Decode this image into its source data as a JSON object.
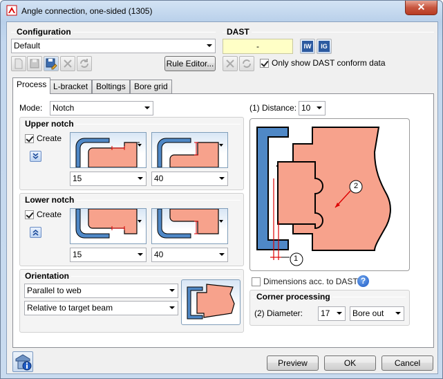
{
  "window": {
    "title": "Angle connection, one-sided (1305)",
    "close_label": "✕"
  },
  "configuration": {
    "title": "Configuration",
    "selected": "Default",
    "rule_editor_label": "Rule Editor..."
  },
  "dast": {
    "title": "DAST",
    "value": "-",
    "iw_label": "IW",
    "ig_label": "IG",
    "only_conform_label": "Only show DAST conform data",
    "only_conform_checked": true
  },
  "tabs": [
    {
      "label": "Process",
      "active": true
    },
    {
      "label": "L-bracket"
    },
    {
      "label": "Boltings"
    },
    {
      "label": "Bore grid"
    }
  ],
  "process": {
    "mode_label": "Mode:",
    "mode_value": "Notch",
    "upper_notch": {
      "title": "Upper notch",
      "create_label": "Create",
      "create_checked": true,
      "value1": "15",
      "value2": "40"
    },
    "lower_notch": {
      "title": "Lower notch",
      "create_label": "Create",
      "create_checked": true,
      "value1": "15",
      "value2": "40"
    },
    "orientation": {
      "title": "Orientation",
      "value1": "Parallel to web",
      "value2": "Relative to target beam"
    },
    "distance_label": "(1) Distance:",
    "distance_value": "10",
    "callout_1": "1",
    "callout_2": "2",
    "dims_dast_label": "Dimensions acc. to DAST",
    "dims_dast_checked": false,
    "help_label": "?",
    "corner": {
      "title": "Corner processing",
      "diameter_label": "(2) Diameter:",
      "diameter_value": "17",
      "type_value": "Bore out"
    }
  },
  "footer": {
    "preview_label": "Preview",
    "ok_label": "OK",
    "cancel_label": "Cancel"
  },
  "colors": {
    "steel_blue": "#4f88c6",
    "steel_salmon": "#f7a28c"
  }
}
